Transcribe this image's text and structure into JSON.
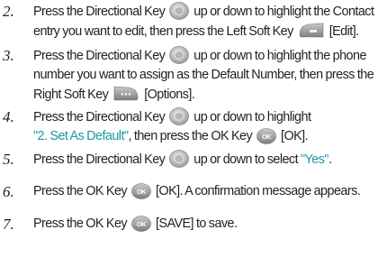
{
  "steps": [
    {
      "number": "2.",
      "line1": {
        "t1": "Press the Directional Key",
        "t2": "up or down to highlight the Contact"
      },
      "line2": {
        "t1": "entry you want to edit, then press the Left Soft Key",
        "t2": "[Edit]."
      }
    },
    {
      "number": "3.",
      "line1": {
        "t1": "Press the Directional Key",
        "t2": "up or down to highlight the phone"
      },
      "line2": {
        "t1": "number you want to assign as the Default Number, then press the"
      },
      "line3": {
        "t1": "Right Soft Key",
        "t2": "[Options]."
      }
    },
    {
      "number": "4.",
      "line1": {
        "t1": "Press the Directional Key",
        "t2": "up or down to highlight"
      },
      "line2": {
        "q": "\"2. Set As Default\"",
        "t1": ", then press the OK Key",
        "t2": "[OK]."
      }
    },
    {
      "number": "5.",
      "line1": {
        "t1": "Press the Directional Key",
        "t2": "up or down to select",
        "q": "\"Yes\"",
        "t3": "."
      }
    },
    {
      "number": "6.",
      "line1": {
        "t1": "Press the OK Key",
        "t2": "[OK]. A confirmation message appears."
      }
    },
    {
      "number": "7.",
      "line1": {
        "t1": "Press the OK Key",
        "t2": "[SAVE] to save."
      }
    }
  ],
  "icons": {
    "directional_key": "directional-key-icon",
    "left_soft_key": "left-soft-key-icon",
    "right_soft_key": "right-soft-key-icon",
    "ok_key": "ok-key-icon",
    "ok_label": "OK"
  },
  "colors": {
    "text": "#231f20",
    "highlight": "#1a9aa8",
    "key_gray": "#8a8c8e"
  }
}
